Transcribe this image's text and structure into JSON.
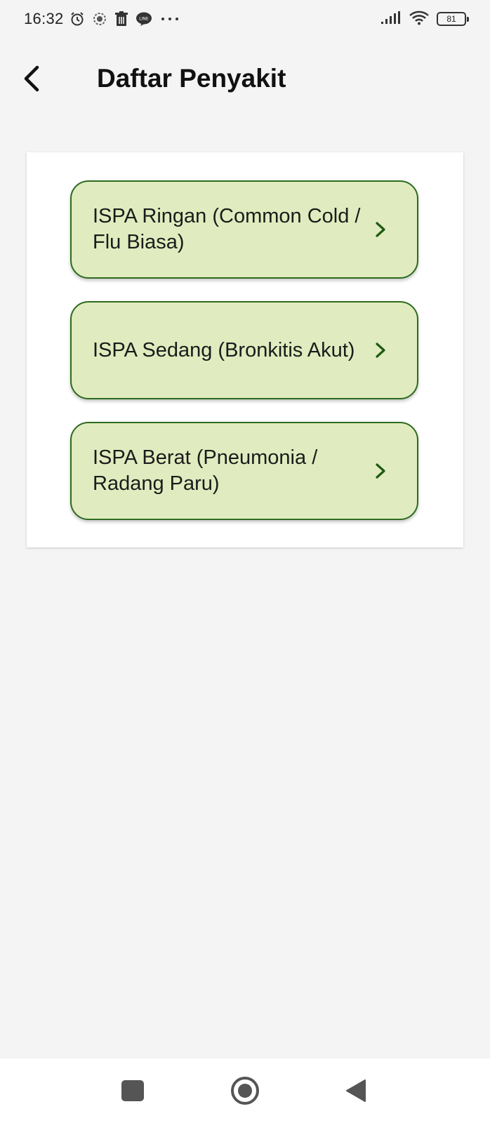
{
  "status_bar": {
    "time": "16:32",
    "left_icons": [
      "alarm-icon",
      "settings-badge-icon",
      "trash-icon",
      "line-app-icon",
      "more-dots-icon"
    ],
    "battery_level": "81"
  },
  "app_bar": {
    "title": "Daftar Penyakit",
    "back_icon": "back-arrow-icon"
  },
  "diseases": [
    {
      "label": "ISPA Ringan (Common Cold / Flu Biasa)"
    },
    {
      "label": "ISPA Sedang (Bronkitis Akut)"
    },
    {
      "label": "ISPA Berat (Pneumonia / Radang Paru)"
    }
  ],
  "colors": {
    "item_background": "#e0ecbf",
    "item_border": "#2e6b1f",
    "chevron": "#1f5a12"
  },
  "nav_bar": {
    "buttons": [
      "recents-icon",
      "home-icon",
      "back-triangle-icon"
    ]
  }
}
